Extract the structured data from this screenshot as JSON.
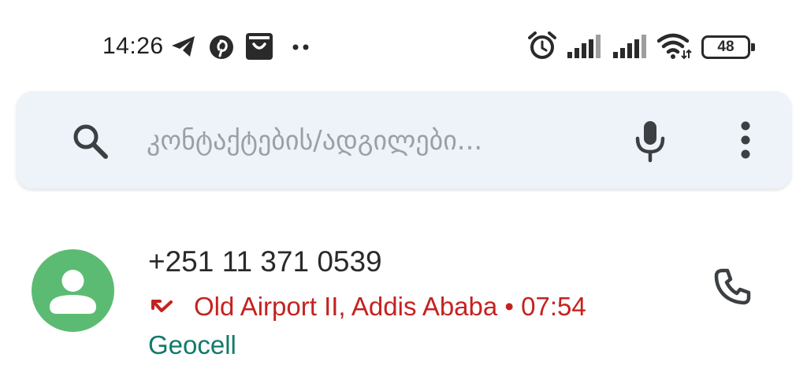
{
  "status_bar": {
    "time": "14:26",
    "battery": "48",
    "icons": [
      "telegram-icon",
      "pinterest-icon",
      "shopping-bag-icon",
      "more-notifications-icon",
      "alarm-icon",
      "signal-icon",
      "signal-icon",
      "wifi-icon",
      "battery-icon"
    ]
  },
  "search": {
    "placeholder": "კონტაქტების/ადგილები..."
  },
  "call_log": [
    {
      "number": "+251 11 371 0539",
      "location": "Old Airport II, Addis Ababa • 07:54",
      "carrier": "Geocell",
      "status": "missed"
    }
  ],
  "colors": {
    "avatar": "#5cbb72",
    "missed": "#c5221f",
    "carrier": "#137a68",
    "search_bg": "#eef2f9"
  }
}
